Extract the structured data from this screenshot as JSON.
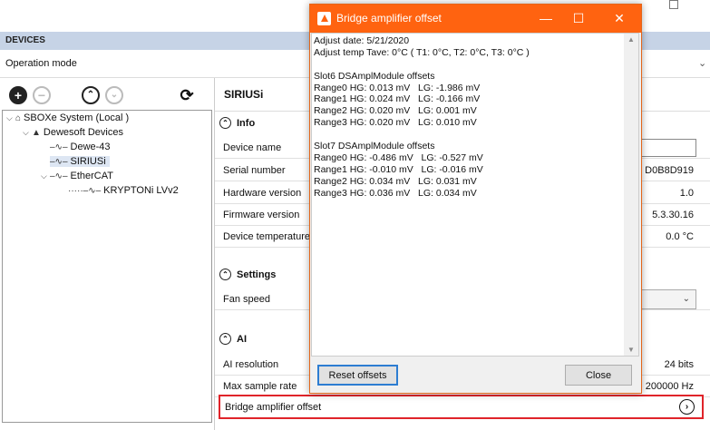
{
  "window": {
    "devices_header": "DEVICES"
  },
  "operation_mode": {
    "label": "Operation mode"
  },
  "tree": {
    "nodes": [
      {
        "label": "SBOXe System (Local )"
      },
      {
        "label": "Dewesoft Devices"
      },
      {
        "label": "Dewe-43"
      },
      {
        "label": "SIRIUSi"
      },
      {
        "label": "EtherCAT"
      },
      {
        "label": "KRYPTONi LVv2"
      }
    ]
  },
  "device": {
    "title": "SIRIUSi",
    "sections": {
      "info": "Info",
      "settings": "Settings",
      "ai": "AI"
    },
    "info_rows": [
      {
        "key": "Device name",
        "value": ""
      },
      {
        "key": "Serial number",
        "value": "D0B8D919"
      },
      {
        "key": "Hardware version",
        "value": "1.0"
      },
      {
        "key": "Firmware version",
        "value": "5.3.30.16"
      },
      {
        "key": "Device temperature",
        "value": "0.0 °C"
      }
    ],
    "settings_rows": [
      {
        "key": "Fan speed",
        "value": ""
      }
    ],
    "ai_rows": [
      {
        "key": "AI resolution",
        "value": "24 bits"
      },
      {
        "key": "Max sample rate",
        "value": "200000 Hz"
      }
    ],
    "bridge_offset_label": "Bridge amplifier offset"
  },
  "dialog": {
    "title": "Bridge amplifier offset",
    "lines": [
      "Adjust date: 5/21/2020",
      "Adjust temp Tave: 0°C ( T1: 0°C, T2: 0°C, T3: 0°C )",
      "",
      "Slot6 DSAmplModule offsets",
      "Range0 HG: 0.013 mV   LG: -1.986 mV",
      "Range1 HG: 0.024 mV   LG: -0.166 mV",
      "Range2 HG: 0.020 mV   LG: 0.001 mV",
      "Range3 HG: 0.020 mV   LG: 0.010 mV",
      "",
      "Slot7 DSAmplModule offsets",
      "Range0 HG: -0.486 mV   LG: -0.527 mV",
      "Range1 HG: -0.010 mV   LG: -0.016 mV",
      "Range2 HG: 0.034 mV   LG: 0.031 mV",
      "Range3 HG: 0.036 mV   LG: 0.034 mV"
    ],
    "reset_label": "Reset offsets",
    "close_label": "Close"
  },
  "colors": {
    "title_bar": "#ff6310",
    "highlight_border": "#e0242a",
    "devices_bar": "#c6d3e6"
  }
}
